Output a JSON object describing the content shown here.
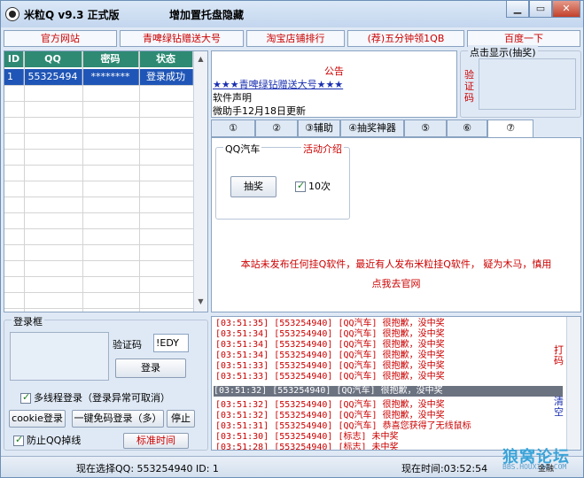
{
  "window": {
    "title": "米粒Q v9.3 正式版",
    "title_link": "增加置托盘隐藏",
    "buttons": [
      "▁",
      "▭",
      "✕"
    ]
  },
  "nav": [
    "官方网站",
    "青啤绿钻赠送大号",
    "淘宝店铺排行",
    "(荐)五分钟领1QB",
    "百度一下"
  ],
  "grid": {
    "headers": [
      "ID",
      "QQ",
      "密码",
      "状态"
    ],
    "rows": [
      {
        "id": "1",
        "qq": "55325494",
        "password": "********",
        "status": "登录成功"
      }
    ]
  },
  "notice": {
    "title": "公告",
    "link": "★★★青啤绿钻赠送大号★★★",
    "lines": [
      "软件声明",
      "微助手12月18日更新"
    ]
  },
  "captcha_display": {
    "label": "点击显示(抽奖)",
    "side": "验证码"
  },
  "tabs": [
    "①",
    "②",
    "③辅助",
    "④抽奖神器",
    "⑤",
    "⑥",
    "⑦"
  ],
  "panel": {
    "group_label": "QQ汽车",
    "activity_label": "活动介绍",
    "draw_button": "抽奖",
    "times_label": "10次",
    "warning_line1": "本站未发布任何挂Q软件，最近有人发布米粒挂Q软件， 疑为木马，慎用",
    "warning_line2": "点我去官网"
  },
  "login": {
    "group_label": "登录框",
    "captcha_label": "验证码",
    "captcha_value": "!EDY",
    "login_button": "登录",
    "multithread_label": "多线程登录（登录异常可取消）",
    "cookie_button": "cookie登录",
    "oneclick_button": "一键免码登录（多）",
    "stop_button": "停止",
    "antidrop_label": "防止QQ掉线",
    "standard_time_button": "标准时间"
  },
  "log": {
    "lines": [
      "[03:51:35] [553254940] [QQ汽车] 很抱歉，没中奖",
      "[03:51:34] [553254940] [QQ汽车] 很抱歉，没中奖",
      "[03:51:34] [553254940] [QQ汽车] 很抱歉，没中奖",
      "[03:51:34] [553254940] [QQ汽车] 很抱歉，没中奖",
      "[03:51:33] [553254940] [QQ汽车] 很抱歉，没中奖",
      "[03:51:33] [553254940] [QQ汽车] 很抱歉，没中奖",
      "[03:51:32] [553254940] [QQ汽车] 很抱歉，没中奖",
      "[03:51:32] [553254940] [QQ汽车] 很抱歉，没中奖",
      "[03:51:32] [553254940] [QQ汽车] 很抱歉，没中奖",
      "[03:51:31] [553254940] [QQ汽车] 恭喜您获得了无线鼠标",
      "[03:51:30] [553254940] [标志] 未中奖",
      "[03:51:28] [553254940] [标志] 未中奖"
    ],
    "side_top": "打码",
    "side_bottom": "清空"
  },
  "status": {
    "current_qq": "现在选择QQ: 553254940   ID: 1",
    "current_time": "现在时间:03:52:54"
  },
  "watermark": {
    "main": "狼窝论坛",
    "sub": "BBS.HOUXIAO.COM",
    "eng": "金融"
  }
}
